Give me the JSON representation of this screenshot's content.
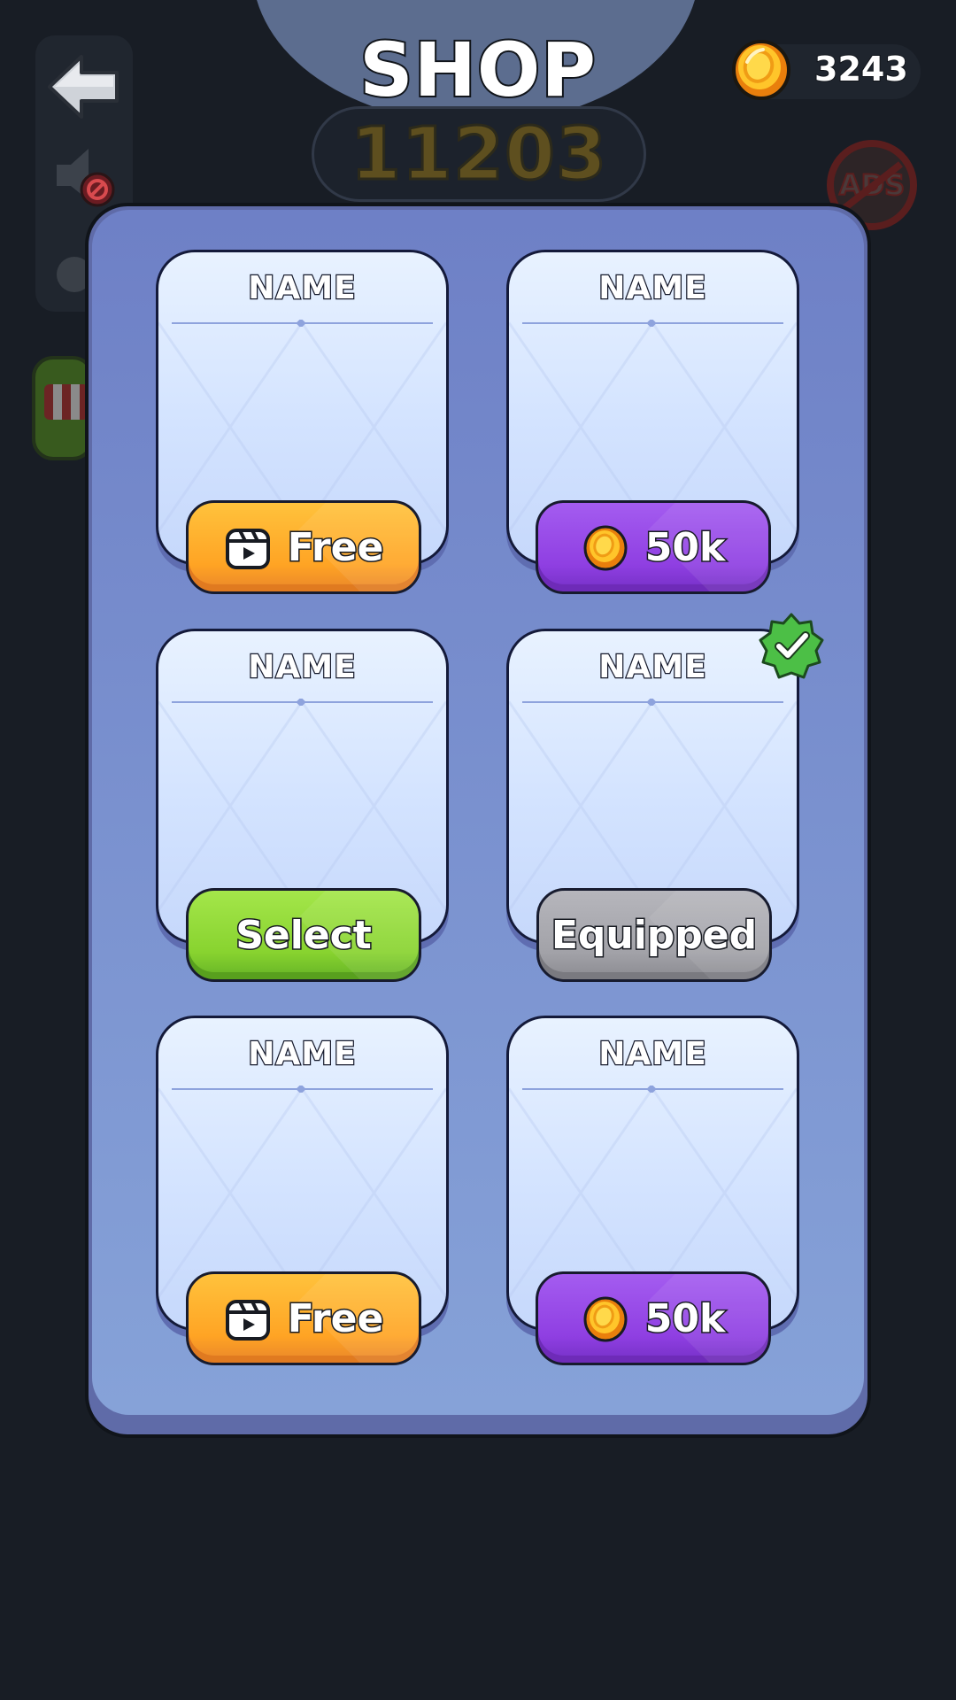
{
  "header": {
    "title": "SHOP",
    "coins": "3243",
    "score": "11203",
    "ads_label": "ADS"
  },
  "icons": {
    "back": "back-arrow-icon",
    "sound": "sound-muted-icon",
    "coin": "coin-icon",
    "reel": "video-reel-icon",
    "check": "check-badge-icon",
    "no_ads": "no-ads-icon",
    "store": "store-icon"
  },
  "colors": {
    "free_button": "#ffa424",
    "price_button": "#8f3fe2",
    "select_button": "#88d32f",
    "equipped_button": "#a2a2a8",
    "panel": "#7a92d0"
  },
  "items": [
    {
      "name": "NAME",
      "button_type": "free",
      "button_label": "Free"
    },
    {
      "name": "NAME",
      "button_type": "price",
      "button_label": "50k"
    },
    {
      "name": "NAME",
      "button_type": "select",
      "button_label": "Select"
    },
    {
      "name": "NAME",
      "button_type": "equipped",
      "button_label": "Equipped",
      "equipped": true
    },
    {
      "name": "NAME",
      "button_type": "free",
      "button_label": "Free"
    },
    {
      "name": "NAME",
      "button_type": "price",
      "button_label": "50k"
    }
  ]
}
